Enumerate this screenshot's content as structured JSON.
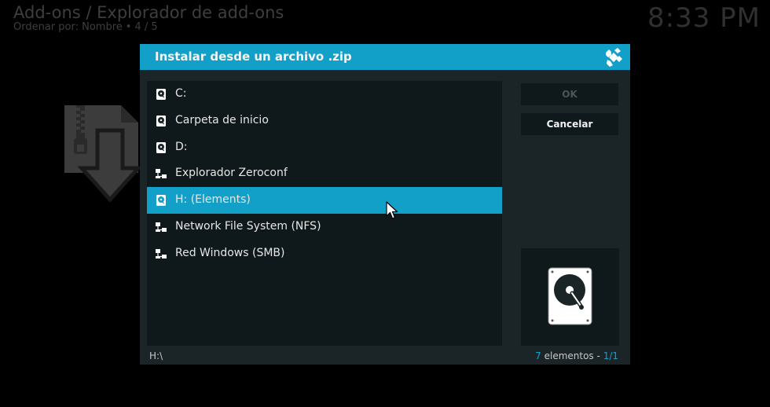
{
  "background": {
    "title": "Add-ons / Explorador de add-ons",
    "sort_label": "Ordenar por: Nombre",
    "separator": "•",
    "position": "4 / 5",
    "clock": "8:33 PM"
  },
  "dialog": {
    "title": "Instalar desde un archivo .zip",
    "items": [
      {
        "label": "C:",
        "icon": "hard-drive-icon"
      },
      {
        "label": "Carpeta de inicio",
        "icon": "hard-drive-icon"
      },
      {
        "label": "D:",
        "icon": "hard-drive-icon"
      },
      {
        "label": "Explorador Zeroconf",
        "icon": "network-icon"
      },
      {
        "label": "H: (Elements)",
        "icon": "hard-drive-icon",
        "selected": true
      },
      {
        "label": "Network File System (NFS)",
        "icon": "network-icon"
      },
      {
        "label": "Red Windows (SMB)",
        "icon": "network-icon"
      }
    ],
    "ok_label": "OK",
    "cancel_label": "Cancelar",
    "current_path": "H:\\",
    "footer": {
      "count": "7",
      "count_text": "elementos",
      "separator": "-",
      "page": "1/1"
    }
  },
  "colors": {
    "accent": "#12a0c8",
    "dialog_bg": "#1b2427",
    "panel_bg": "#0f181b"
  }
}
